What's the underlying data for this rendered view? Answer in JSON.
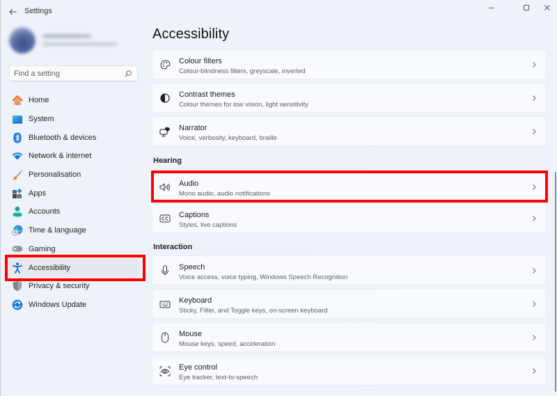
{
  "window": {
    "title": "Settings",
    "controls": {
      "minimize": "minimize-icon",
      "maximize": "maximize-icon",
      "close": "close-icon"
    }
  },
  "search": {
    "placeholder": "Find a setting",
    "value": ""
  },
  "sidebar": {
    "items": [
      {
        "label": "Home",
        "icon": "home-icon",
        "selected": false
      },
      {
        "label": "System",
        "icon": "system-icon",
        "selected": false
      },
      {
        "label": "Bluetooth & devices",
        "icon": "bluetooth-icon",
        "selected": false
      },
      {
        "label": "Network & internet",
        "icon": "wifi-icon",
        "selected": false
      },
      {
        "label": "Personalisation",
        "icon": "brush-icon",
        "selected": false
      },
      {
        "label": "Apps",
        "icon": "apps-icon",
        "selected": false
      },
      {
        "label": "Accounts",
        "icon": "account-icon",
        "selected": false
      },
      {
        "label": "Time & language",
        "icon": "globe-clock-icon",
        "selected": false
      },
      {
        "label": "Gaming",
        "icon": "gamepad-icon",
        "selected": false
      },
      {
        "label": "Accessibility",
        "icon": "accessibility-icon",
        "selected": true
      },
      {
        "label": "Privacy & security",
        "icon": "shield-icon",
        "selected": false
      },
      {
        "label": "Windows Update",
        "icon": "update-icon",
        "selected": false
      }
    ]
  },
  "main": {
    "title": "Accessibility",
    "vision_items": [
      {
        "title": "Colour filters",
        "subtitle": "Colour-blindness filters, greyscale, inverted",
        "icon": "palette-icon"
      },
      {
        "title": "Contrast themes",
        "subtitle": "Colour themes for low vision, light sensitivity",
        "icon": "contrast-icon"
      },
      {
        "title": "Narrator",
        "subtitle": "Voice, verbosity, keyboard, braille",
        "icon": "narrator-icon"
      }
    ],
    "hearing": {
      "label": "Hearing",
      "items": [
        {
          "title": "Audio",
          "subtitle": "Mono audio, audio notifications",
          "icon": "speaker-icon"
        },
        {
          "title": "Captions",
          "subtitle": "Styles, live captions",
          "icon": "captions-icon"
        }
      ]
    },
    "interaction": {
      "label": "Interaction",
      "items": [
        {
          "title": "Speech",
          "subtitle": "Voice access, voice typing, Windows Speech Recognition",
          "icon": "microphone-icon"
        },
        {
          "title": "Keyboard",
          "subtitle": "Sticky, Filter, and Toggle keys, on-screen keyboard",
          "icon": "keyboard-icon"
        },
        {
          "title": "Mouse",
          "subtitle": "Mouse keys, speed, acceleration",
          "icon": "mouse-icon"
        },
        {
          "title": "Eye control",
          "subtitle": "Eye tracker, text-to-speech",
          "icon": "eye-control-icon"
        }
      ]
    }
  },
  "colors": {
    "background": "#eff3f9",
    "card": "#f9fafd",
    "accent": "#2a58c6",
    "highlight": "#ff0000"
  }
}
